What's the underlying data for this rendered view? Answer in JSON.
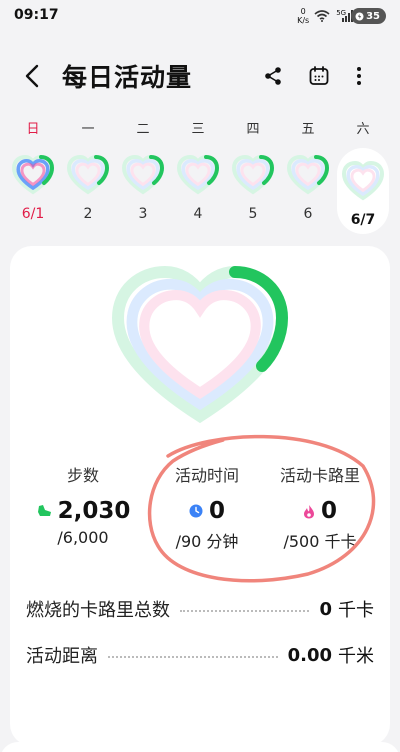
{
  "status": {
    "time": "09:17",
    "net_top": "0",
    "net_bottom": "K/s",
    "signal_label": "5G",
    "battery": "35"
  },
  "header": {
    "title": "每日活动量"
  },
  "days": [
    {
      "label": "日",
      "date": "6/1",
      "red": true
    },
    {
      "label": "一",
      "date": "2"
    },
    {
      "label": "二",
      "date": "3"
    },
    {
      "label": "三",
      "date": "4"
    },
    {
      "label": "四",
      "date": "5"
    },
    {
      "label": "五",
      "date": "6"
    },
    {
      "label": "六",
      "date": "6/7",
      "selected": true
    }
  ],
  "stats": {
    "steps": {
      "label": "步数",
      "value": "2,030",
      "goal": "/6,000"
    },
    "time": {
      "label": "活动时间",
      "value": "0",
      "goal": "/90 分钟"
    },
    "calories": {
      "label": "活动卡路里",
      "value": "0",
      "goal": "/500 千卡"
    }
  },
  "rows": {
    "burned": {
      "label": "燃烧的卡路里总数",
      "value": "0",
      "unit": "千卡"
    },
    "distance": {
      "label": "活动距离",
      "value": "0.00",
      "unit": "千米"
    }
  },
  "colors": {
    "green": "#22c55e",
    "blue": "#3b82f6",
    "pink": "#ec4899",
    "ring_green": "#d6f5e3",
    "ring_blue": "#dbeafe",
    "ring_pink": "#fde2ee",
    "annotation": "#f0857c"
  }
}
